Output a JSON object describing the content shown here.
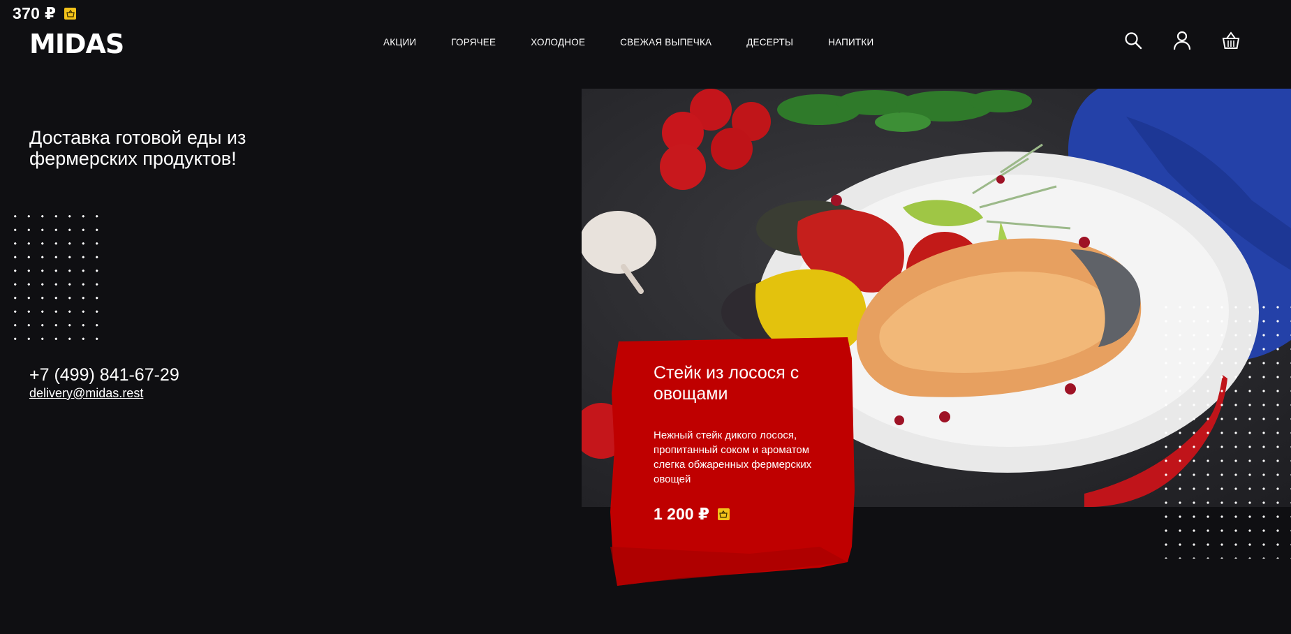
{
  "top_bar": {
    "price": "370 ₽",
    "basket_icon": "basket-icon"
  },
  "header": {
    "logo": "MIDAS",
    "nav": [
      "АКЦИИ",
      "ГОРЯЧЕЕ",
      "ХОЛОДНОЕ",
      "СВЕЖАЯ ВЫПЕЧКА",
      "ДЕСЕРТЫ",
      "НАПИТКИ"
    ],
    "icons": [
      "search-icon",
      "user-icon",
      "cart-icon"
    ]
  },
  "hero": {
    "title": "Доставка готовой еды из фермерских продуктов!",
    "phone": "+7 (499) 841-67-29",
    "email": "delivery@midas.rest"
  },
  "promo": {
    "title": "Стейк из лосося с овощами",
    "description": "Нежный стейк дикого лосося, пропитанный соком и ароматом слегка обжаренных фермерских овощей",
    "price": "1 200 ₽"
  },
  "colors": {
    "background": "#0f0f12",
    "accent_red": "#c00000",
    "badge_yellow": "#f2c21a",
    "text": "#ffffff"
  }
}
